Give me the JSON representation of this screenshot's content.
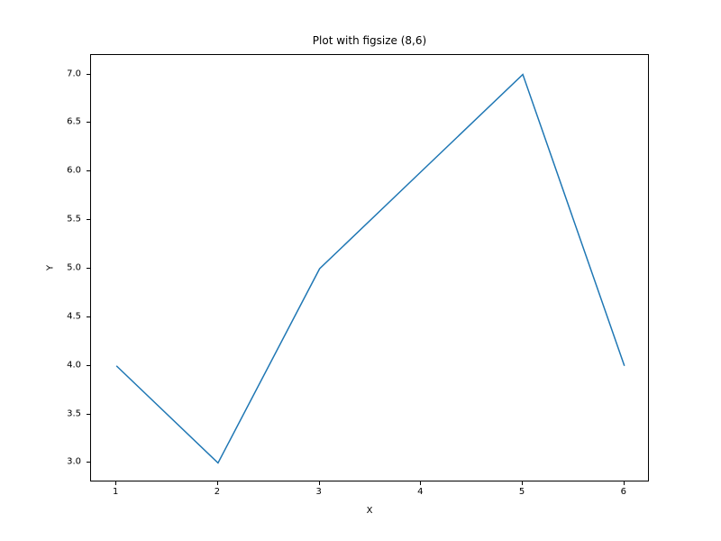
{
  "chart_data": {
    "type": "line",
    "title": "Plot with figsize (8,6)",
    "xlabel": "X",
    "ylabel": "Y",
    "x": [
      1,
      2,
      3,
      4,
      5,
      6
    ],
    "y": [
      4,
      3,
      5,
      6,
      7,
      4
    ],
    "xticks": [
      1,
      2,
      3,
      4,
      5,
      6
    ],
    "yticks": [
      3.0,
      3.5,
      4.0,
      4.5,
      5.0,
      5.5,
      6.0,
      6.5,
      7.0
    ],
    "ytick_labels": [
      "3.0",
      "3.5",
      "4.0",
      "4.5",
      "5.0",
      "5.5",
      "6.0",
      "6.5",
      "7.0"
    ],
    "xlim": [
      0.75,
      6.25
    ],
    "ylim": [
      2.8,
      7.2
    ],
    "line_color": "#1f77b4"
  }
}
